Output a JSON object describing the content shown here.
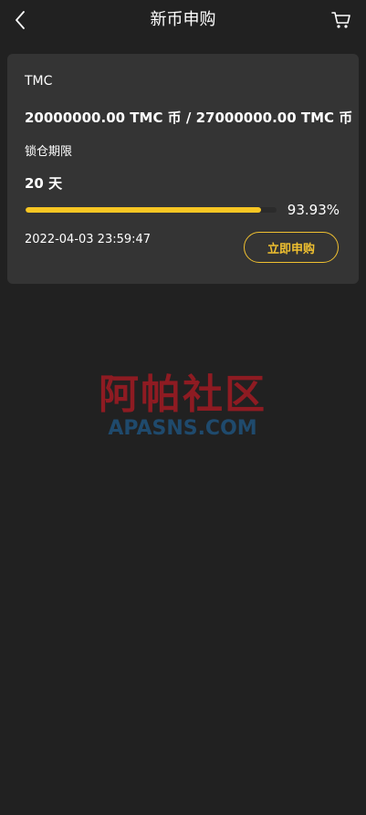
{
  "header": {
    "title": "新币申购"
  },
  "card": {
    "coin_name": "TMC",
    "amounts": "20000000.00 TMC 币 / 27000000.00 TMC 币",
    "lock_label": "锁仓期限",
    "lock_value": "20 天",
    "progress_percent": 93.93,
    "progress_text": "93.93%",
    "deadline": "2022-04-03 23:59:47",
    "subscribe_label": "立即申购"
  },
  "watermark": {
    "cn": "阿帕社区",
    "en": "APASNS.COM"
  },
  "colors": {
    "background": "#212121",
    "card": "#343434",
    "accent": "#f7c623",
    "watermark_red": "#8e1b22",
    "watermark_blue": "#1f4a6d"
  }
}
